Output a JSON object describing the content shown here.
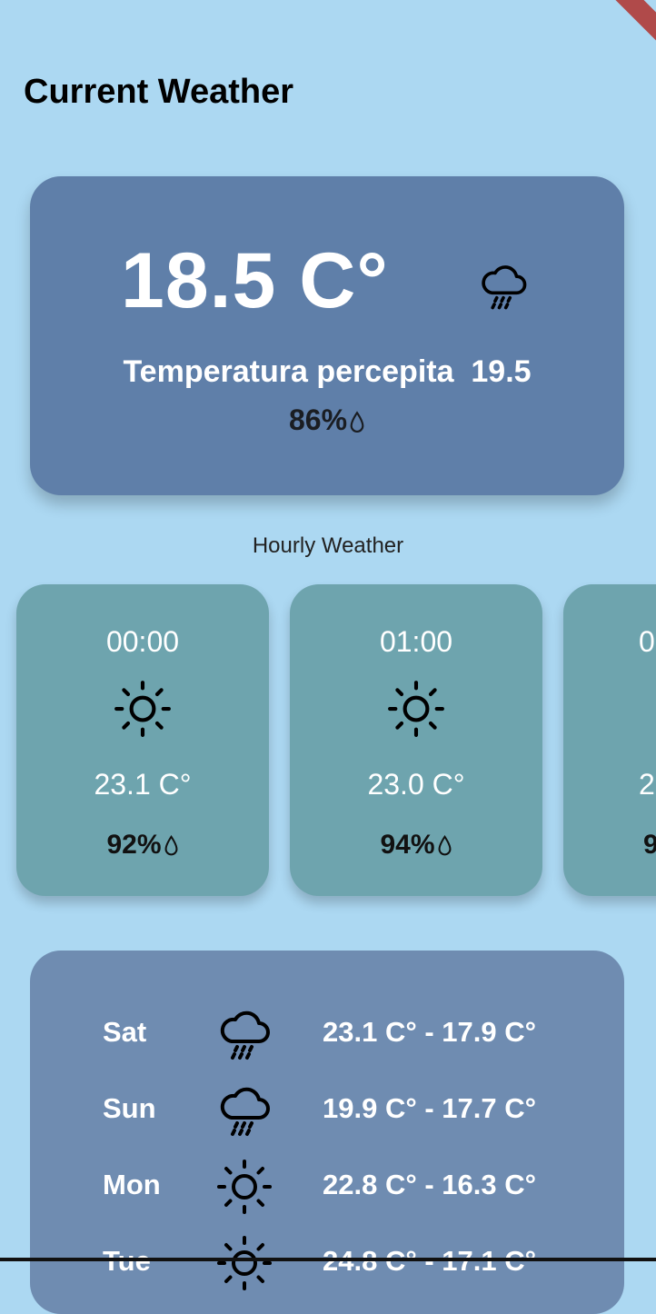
{
  "header": {
    "title": "Current Weather"
  },
  "current": {
    "temperature": "18.5 C°",
    "feels_like": "Temperatura percepita  19.5",
    "humidity": "86%",
    "icon": "rain-cloud-icon"
  },
  "hourly": {
    "label": "Hourly Weather",
    "items": [
      {
        "time": "00:00",
        "temp": "23.1 C°",
        "humidity": "92%",
        "icon": "sun-icon"
      },
      {
        "time": "01:00",
        "temp": "23.0 C°",
        "humidity": "94%",
        "icon": "sun-icon"
      },
      {
        "time": "0",
        "temp": "2",
        "humidity": "9",
        "icon": "sun-icon"
      }
    ]
  },
  "daily": {
    "items": [
      {
        "day": "Sat",
        "range": "23.1 C° - 17.9 C°",
        "icon": "rain-cloud-icon"
      },
      {
        "day": "Sun",
        "range": "19.9 C° - 17.7 C°",
        "icon": "rain-cloud-icon"
      },
      {
        "day": "Mon",
        "range": "22.8 C° - 16.3 C°",
        "icon": "sun-icon"
      },
      {
        "day": "Tue",
        "range": "24.8 C° - 17.1 C°",
        "icon": "sun-icon"
      }
    ]
  },
  "colors": {
    "background": "#acd8f2",
    "current_card": "#5f7fa9",
    "hour_card": "#6ea4ae",
    "forecast_card": "#6f8cb1"
  }
}
